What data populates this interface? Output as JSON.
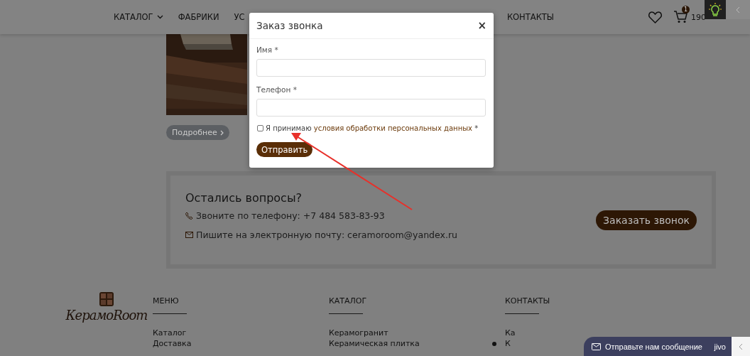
{
  "nav": {
    "items": [
      {
        "label": "КАТАЛОГ",
        "dropdown": true
      },
      {
        "label": "ФАБРИКИ",
        "dropdown": false
      },
      {
        "label": "УС",
        "dropdown": false
      },
      {
        "label": "КОНТАКТЫ",
        "dropdown": false
      }
    ],
    "cart_count": "1",
    "cart_total": "190"
  },
  "product": {
    "button": "Подробнее"
  },
  "modal": {
    "title": "Заказ звонка",
    "close": "×",
    "fields": [
      {
        "label": "Имя *"
      },
      {
        "label": "Телефон *"
      }
    ],
    "consent": {
      "checked": false,
      "text": "Я принимаю",
      "link": "условия обработки персональных данных",
      "required_mark": "*"
    },
    "submit": "Отправить"
  },
  "questions": {
    "title": "Остались вопросы?",
    "phone": "Звоните по телефону: +7 484 583-83-93",
    "email": "Пишите на электронную почту: ceramoroom@yandex.ru",
    "button": "Заказать звонок"
  },
  "footer": {
    "logo": "КерамоRoom",
    "columns": [
      {
        "title": "МЕНЮ",
        "items": [
          "Каталог",
          "Доставка"
        ]
      },
      {
        "title": "КАТАЛОГ",
        "items": [
          "Керамогранит",
          "Керамическая плитка"
        ]
      },
      {
        "title": "КОНТАКТЫ",
        "items": [
          "Ка",
          "К"
        ]
      }
    ]
  },
  "chat": {
    "label": "Отправьте нам сообщение",
    "brand": "jivo"
  }
}
